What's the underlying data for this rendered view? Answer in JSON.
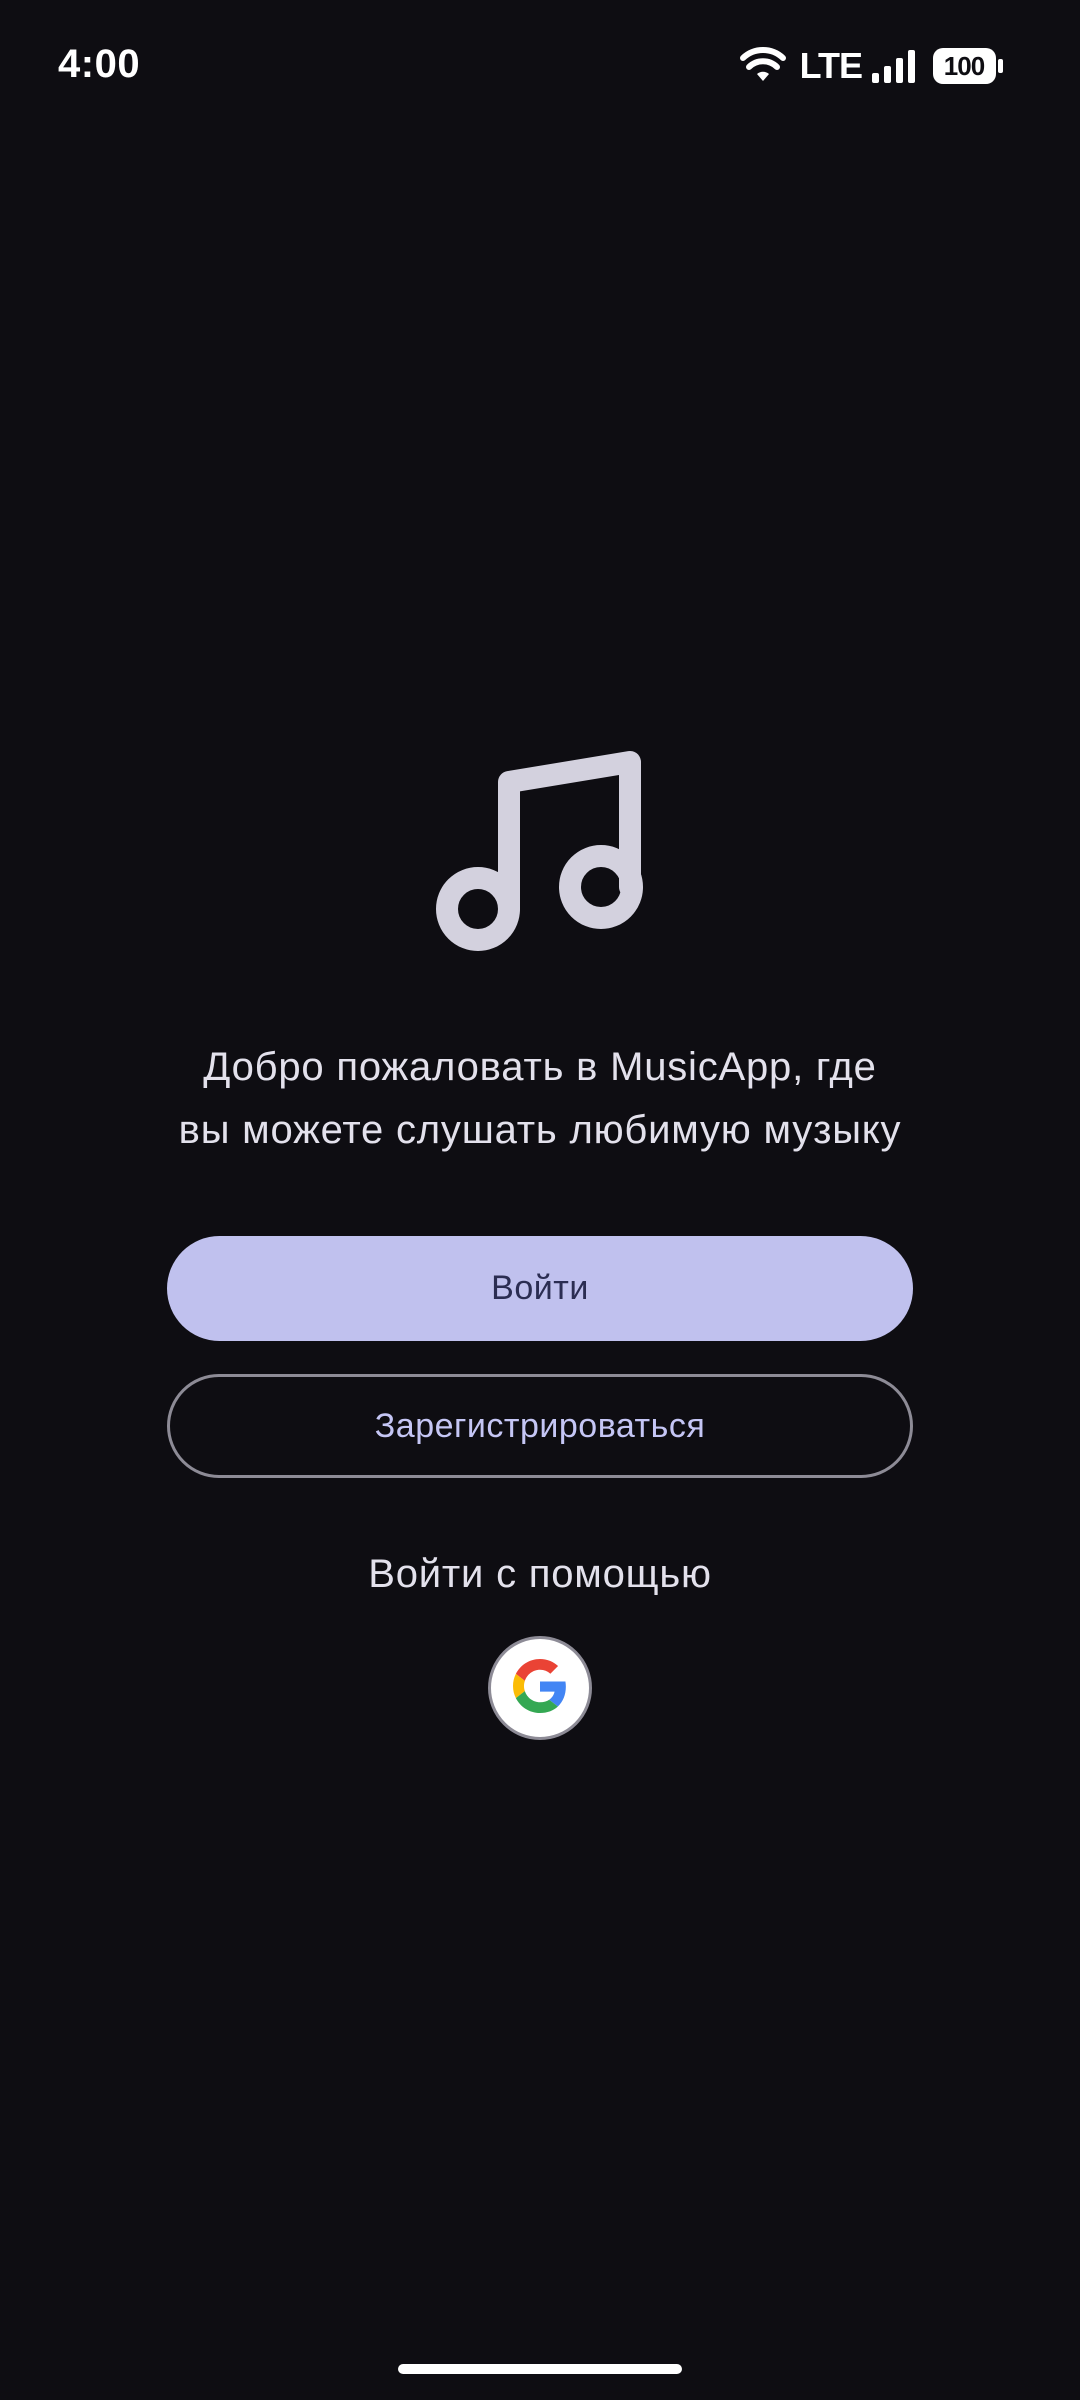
{
  "status_bar": {
    "time": "4:00",
    "network_label": "LTE",
    "battery": "100"
  },
  "hero": {
    "icon": "music-note-icon",
    "welcome_line1": "Добро пожаловать в MusicApp, где",
    "welcome_line2": "вы можете слушать любимую музыку"
  },
  "actions": {
    "login_label": "Войти",
    "register_label": "Зарегистрироваться"
  },
  "social": {
    "label": "Войти с помощью",
    "google_icon": "google-icon"
  },
  "colors": {
    "background": "#0e0d12",
    "primary": "#c0c1ee",
    "on_primary": "#2b2d52",
    "outline": "#8d8b96",
    "text": "#e3e1ec",
    "link_text": "#c5c6f5"
  }
}
